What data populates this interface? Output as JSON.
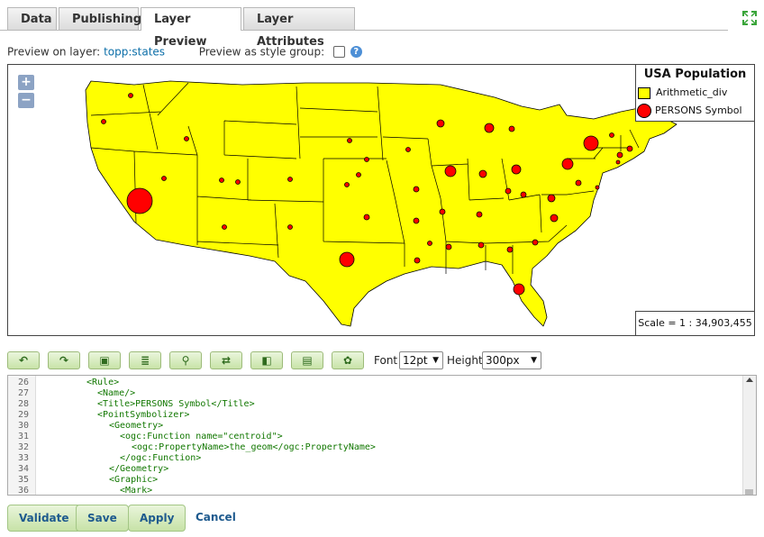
{
  "tabs": [
    {
      "label": "Data"
    },
    {
      "label": "Publishing"
    },
    {
      "label": "Layer Preview"
    },
    {
      "label": "Layer Attributes"
    }
  ],
  "preview": {
    "layer_label": "Preview on layer:",
    "layer_name": "topp:states",
    "style_group_label": "Preview as style group:",
    "help": "?"
  },
  "map": {
    "zoom_in": "+",
    "zoom_out": "−",
    "legend_title": "USA Population",
    "legend_items": [
      {
        "label": "Arithmetic_div"
      },
      {
        "label": "PERSONS Symbol"
      }
    ],
    "scale": "Scale = 1 : 34,903,455",
    "fill_color": "#ffff00",
    "symbol_color": "#ff0000"
  },
  "toolbar": {
    "buttons": [
      "undo",
      "redo",
      "insert-image",
      "indent",
      "find",
      "replace",
      "color-picker",
      "image",
      "palette"
    ],
    "font_label": "Font",
    "font_value": "12pt",
    "height_label": "Height",
    "height_value": "300px"
  },
  "editor": {
    "lines": [
      {
        "n": "26",
        "text": "<Rule>"
      },
      {
        "n": "27",
        "text": "<Name/>"
      },
      {
        "n": "28",
        "text": "<Title>PERSONS Symbol</Title>"
      },
      {
        "n": "29",
        "text": "<PointSymbolizer>"
      },
      {
        "n": "30",
        "text": "<Geometry>"
      },
      {
        "n": "31",
        "text": "<ogc:Function name=\"centroid\">"
      },
      {
        "n": "32",
        "text": "<ogc:PropertyName>the_geom</ogc:PropertyName>"
      },
      {
        "n": "33",
        "text": "</ogc:Function>"
      },
      {
        "n": "34",
        "text": "</Geometry>"
      },
      {
        "n": "35",
        "text": "<Graphic>"
      },
      {
        "n": "36",
        "text": "<Mark>"
      }
    ]
  },
  "actions": {
    "validate": "Validate",
    "save": "Save",
    "apply": "Apply",
    "cancel": "Cancel"
  }
}
